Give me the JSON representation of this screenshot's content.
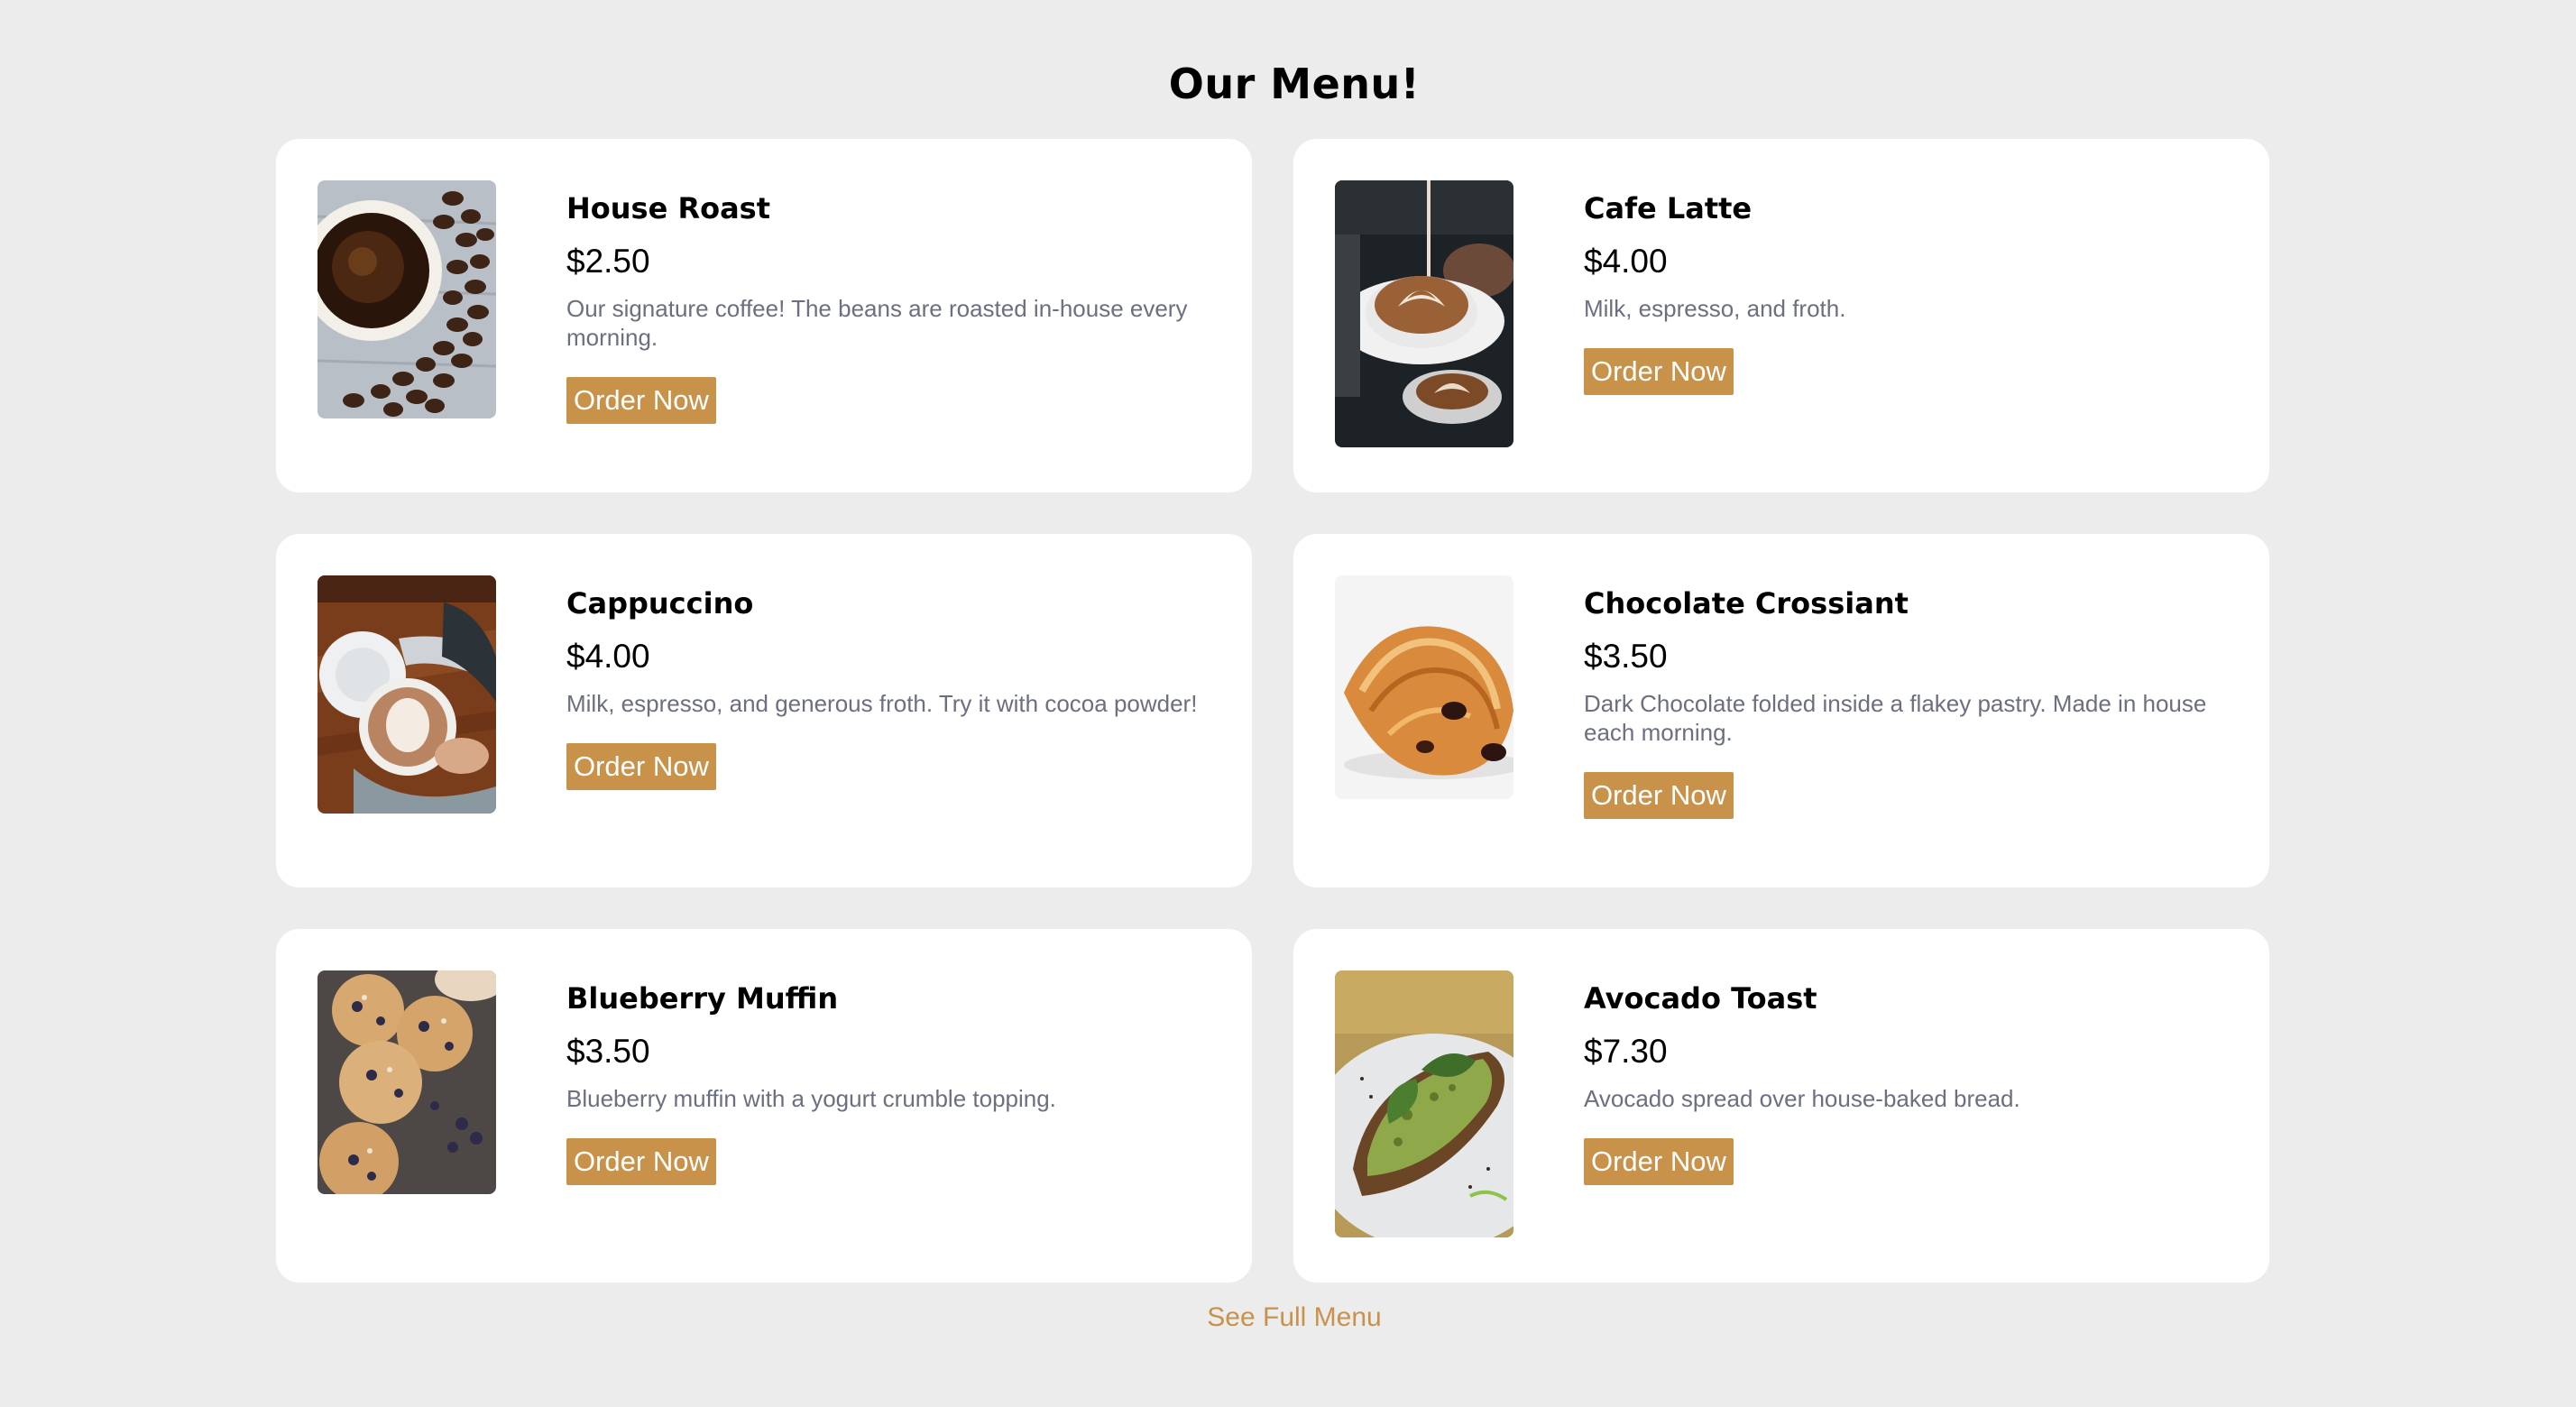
{
  "header": {
    "title": "Our Menu!"
  },
  "accent_color": "#c9924a",
  "items": [
    {
      "name": "House Roast",
      "price": "$2.50",
      "description": "Our signature coffee! The beans are roasted in-house every morning.",
      "button": "Order Now",
      "image": "coffee-cup-with-beans"
    },
    {
      "name": "Cafe Latte",
      "price": "$4.00",
      "description": "Milk, espresso, and froth.",
      "button": "Order Now",
      "image": "latte-art-pour"
    },
    {
      "name": "Cappuccino",
      "price": "$4.00",
      "description": "Milk, espresso, and generous froth. Try it with cocoa powder!",
      "button": "Order Now",
      "image": "cappuccino-in-hands"
    },
    {
      "name": "Chocolate Crossiant",
      "price": "$3.50",
      "description": "Dark Chocolate folded inside a flakey pastry. Made in house each morning.",
      "button": "Order Now",
      "image": "chocolate-croissant"
    },
    {
      "name": "Blueberry Muffin",
      "price": "$3.50",
      "description": "Blueberry muffin with a yogurt crumble topping.",
      "button": "Order Now",
      "image": "blueberry-muffins"
    },
    {
      "name": "Avocado Toast",
      "price": "$7.30",
      "description": "Avocado spread over house-baked bread.",
      "button": "Order Now",
      "image": "avocado-toast"
    }
  ],
  "footer": {
    "link": "See Full Menu"
  }
}
